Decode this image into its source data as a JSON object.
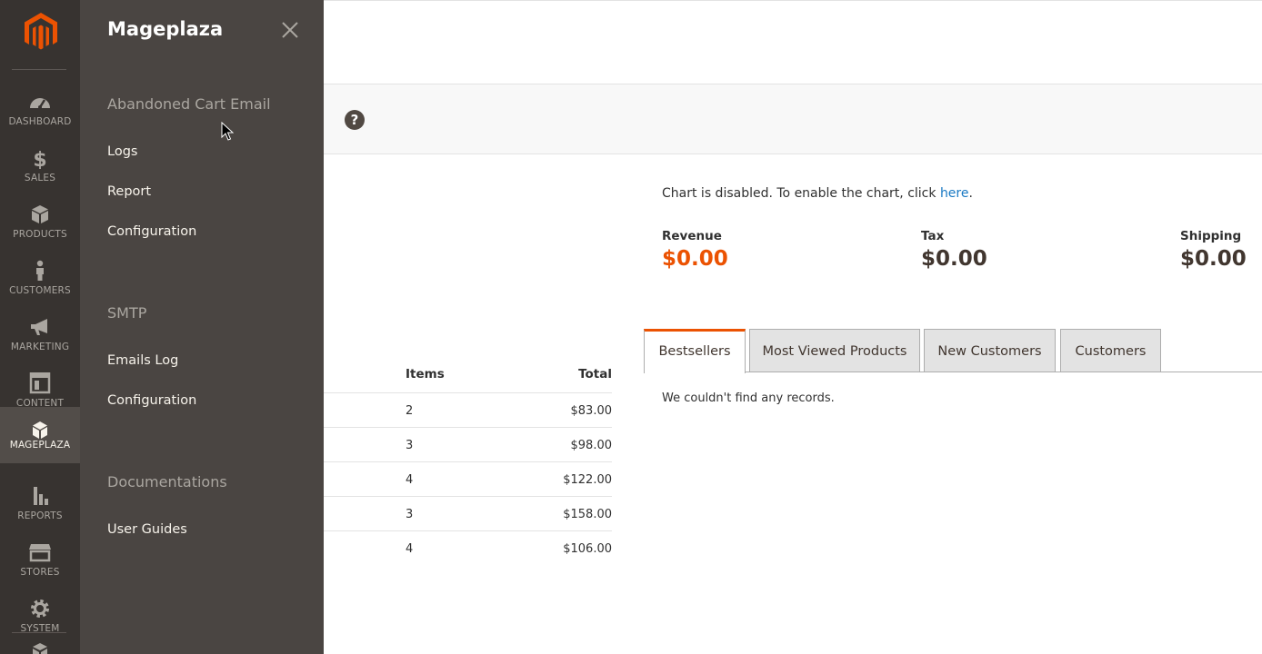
{
  "nav": {
    "items": [
      {
        "label": "DASHBOARD",
        "icon": "dashboard-icon"
      },
      {
        "label": "SALES",
        "icon": "dollar-icon"
      },
      {
        "label": "PRODUCTS",
        "icon": "box-icon"
      },
      {
        "label": "CUSTOMERS",
        "icon": "person-icon"
      },
      {
        "label": "MARKETING",
        "icon": "megaphone-icon"
      },
      {
        "label": "CONTENT",
        "icon": "layout-icon"
      },
      {
        "label": "MAGEPLAZA",
        "icon": "mageplaza-icon"
      },
      {
        "label": "REPORTS",
        "icon": "bar-chart-icon"
      },
      {
        "label": "STORES",
        "icon": "store-icon"
      },
      {
        "label": "SYSTEM",
        "icon": "gear-icon"
      }
    ]
  },
  "panel": {
    "title": "Mageplaza",
    "groups": [
      {
        "title": "Abandoned Cart Email",
        "links": [
          "Logs",
          "Report",
          "Configuration"
        ]
      },
      {
        "title": "SMTP",
        "links": [
          "Emails Log",
          "Configuration"
        ]
      },
      {
        "title": "Documentations",
        "links": [
          "User Guides"
        ]
      }
    ]
  },
  "dashboard": {
    "chart_message": "Chart is disabled. To enable the chart, click ",
    "chart_link": "here",
    "chart_message_end": ".",
    "stats": [
      {
        "label": "Revenue",
        "value": "$0.00"
      },
      {
        "label": "Tax",
        "value": "$0.00"
      },
      {
        "label": "Shipping",
        "value": "$0.00"
      }
    ],
    "orders": {
      "headers": [
        "Items",
        "Total"
      ],
      "rows": [
        [
          "2",
          "$83.00"
        ],
        [
          "3",
          "$98.00"
        ],
        [
          "4",
          "$122.00"
        ],
        [
          "3",
          "$158.00"
        ],
        [
          "4",
          "$106.00"
        ]
      ]
    },
    "tabs": [
      "Bestsellers",
      "Most Viewed Products",
      "New Customers",
      "Customers"
    ],
    "empty_message": "We couldn't find any records."
  },
  "colors": {
    "accent": "#eb5202",
    "nav_bg": "#373330",
    "panel_bg": "#4a4542",
    "link": "#1979c3"
  }
}
